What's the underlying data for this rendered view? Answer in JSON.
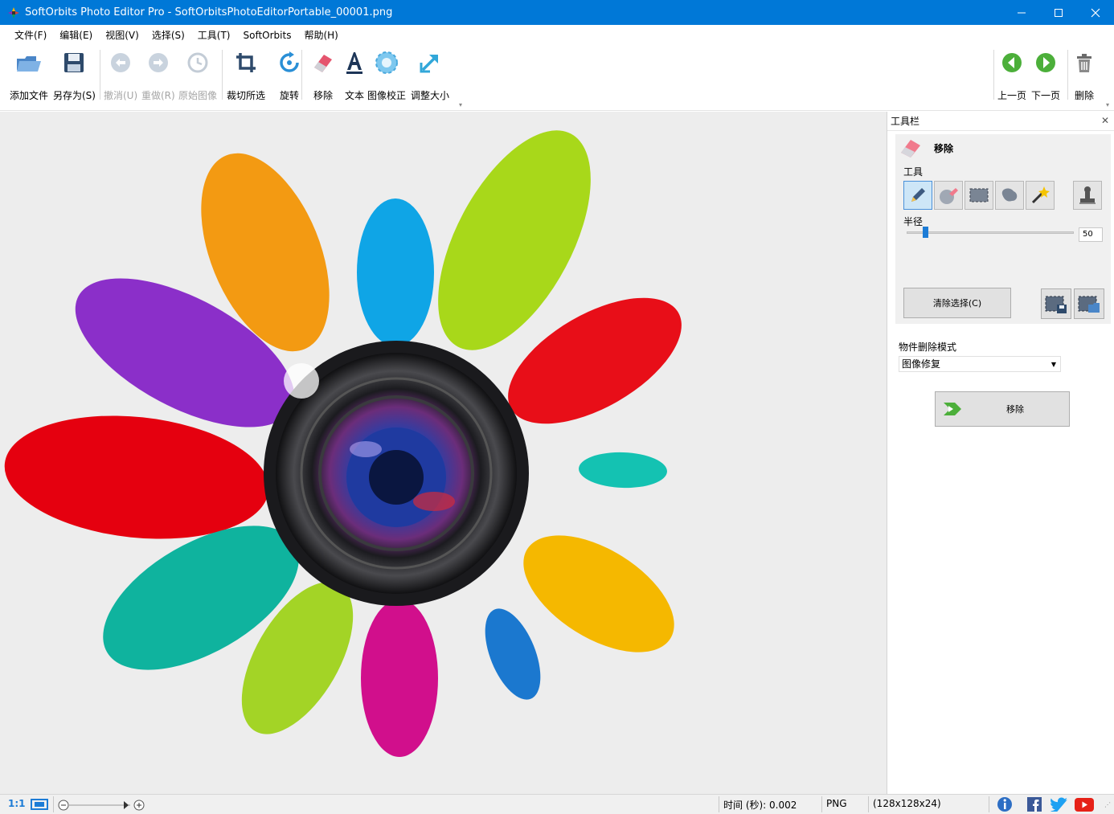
{
  "window": {
    "title": "SoftOrbits Photo Editor Pro - SoftOrbitsPhotoEditorPortable_00001.png",
    "controls": [
      "minimize",
      "maximize",
      "close"
    ]
  },
  "menu": [
    "文件(F)",
    "编辑(E)",
    "视图(V)",
    "选择(S)",
    "工具(T)",
    "SoftOrbits",
    "帮助(H)"
  ],
  "toolbar": {
    "add_file": "添加文件",
    "save_as": "另存为(S)",
    "undo": "撤消(U)",
    "redo": "重做(R)",
    "original": "原始图像",
    "crop": "裁切所选",
    "rotate": "旋转",
    "remove": "移除",
    "text": "文本",
    "correct": "图像校正",
    "resize": "调整大小",
    "prev": "上一页",
    "next": "下一页",
    "delete": "删除"
  },
  "panel": {
    "header": "工具栏",
    "section_title": "移除",
    "tools_label": "工具",
    "radius_label": "半径",
    "radius_value": "50",
    "radius_fraction": 0.12,
    "clear_selection": "清除选择(C)",
    "mode_label": "物件删除模式",
    "mode_value": "图像修复",
    "run_button": "移除"
  },
  "status": {
    "ratio": "1:1",
    "time": "时间 (秒): 0.002",
    "format": "PNG",
    "dims": "(128x128x24)"
  },
  "colors": {
    "titlebar": "#0078d7",
    "accent": "#1d7cd6",
    "canvas_bg": "#ededed"
  }
}
